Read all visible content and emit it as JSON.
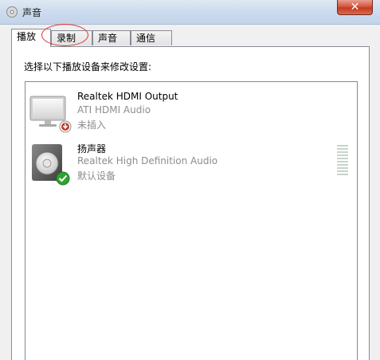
{
  "window": {
    "title": "声音",
    "close_label": "✕"
  },
  "tabs": [
    {
      "label": "播放",
      "active": true
    },
    {
      "label": "录制",
      "active": false
    },
    {
      "label": "声音",
      "active": false
    },
    {
      "label": "通信",
      "active": false
    }
  ],
  "playback": {
    "instruction": "选择以下播放设备来修改设置:",
    "devices": [
      {
        "name": "Realtek HDMI Output",
        "driver": "ATI HDMI Audio",
        "status": "未插入",
        "icon": "monitor-icon",
        "status_icon": "unplugged-icon"
      },
      {
        "name": "扬声器",
        "driver": "Realtek High Definition Audio",
        "status": "默认设备",
        "icon": "speaker-icon",
        "status_icon": "default-check-icon"
      }
    ]
  },
  "colors": {
    "close_button": "#c33b1f",
    "default_check": "#2fa32f",
    "unplugged_badge": "#c0392b",
    "secondary_text": "#8d8d8d",
    "annotation_ellipse": "#e03030"
  }
}
